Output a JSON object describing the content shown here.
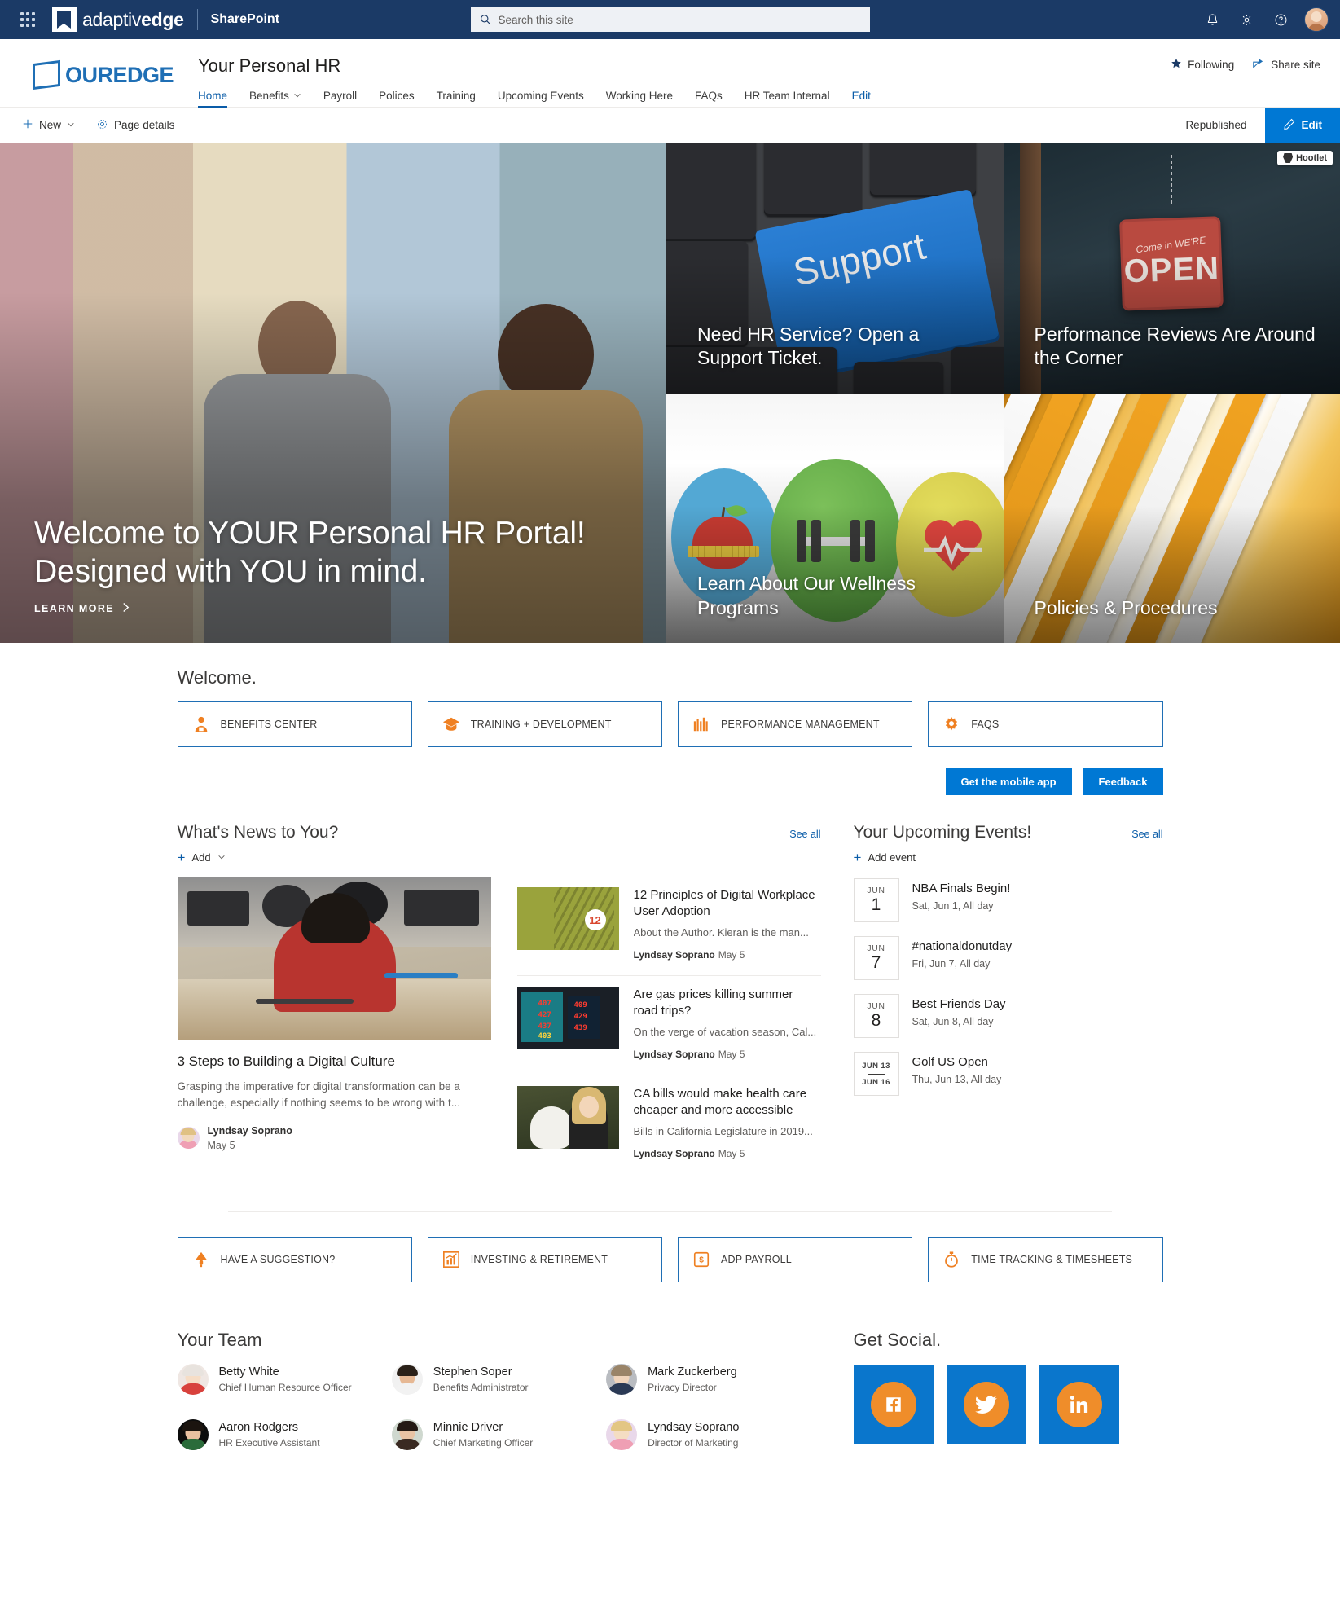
{
  "suite": {
    "brand_primary": "adaptiv",
    "brand_secondary": "edge",
    "app_name": "SharePoint",
    "search_placeholder": "Search this site",
    "search_value": "",
    "waffle_label": "app-launcher",
    "notifications_label": "Notifications",
    "settings_label": "Settings",
    "help_label": "Help",
    "bar_color": "#1b3a66"
  },
  "site": {
    "logo_text": "OUREDGE",
    "title": "Your Personal HR",
    "nav": [
      {
        "label": "Home",
        "active": true,
        "caret": false,
        "link": false
      },
      {
        "label": "Benefits",
        "active": false,
        "caret": true,
        "link": false
      },
      {
        "label": "Payroll",
        "active": false,
        "caret": false,
        "link": false
      },
      {
        "label": "Polices",
        "active": false,
        "caret": false,
        "link": false
      },
      {
        "label": "Training",
        "active": false,
        "caret": false,
        "link": false
      },
      {
        "label": "Upcoming Events",
        "active": false,
        "caret": false,
        "link": false
      },
      {
        "label": "Working Here",
        "active": false,
        "caret": false,
        "link": false
      },
      {
        "label": "FAQs",
        "active": false,
        "caret": false,
        "link": false
      },
      {
        "label": "HR Team Internal",
        "active": false,
        "caret": false,
        "link": false
      },
      {
        "label": "Edit",
        "active": false,
        "caret": false,
        "link": true
      }
    ],
    "following": "Following",
    "share_site": "Share site"
  },
  "commandbar": {
    "new": "New",
    "page_details": "Page details",
    "status": "Republished",
    "edit": "Edit",
    "edit_color": "#0078d4"
  },
  "hero": {
    "main": {
      "headline": "Welcome to YOUR Personal HR Portal! Designed with YOU in mind.",
      "cta": "LEARN MORE"
    },
    "tiles": [
      {
        "label": "Need HR Service? Open a Support Ticket.",
        "key_text": "Support"
      },
      {
        "label": "Performance Reviews Are Around the Corner",
        "sign_top": "Come in WE'RE",
        "sign_main": "OPEN",
        "watermark": "Hootlet"
      },
      {
        "label": "Learn About Our Wellness Programs"
      },
      {
        "label": "Policies & Procedures"
      }
    ]
  },
  "welcome": {
    "title": "Welcome.",
    "links": [
      {
        "label": "BENEFITS CENTER",
        "icon": "person-badge-icon"
      },
      {
        "label": "TRAINING + DEVELOPMENT",
        "icon": "graduation-cap-icon"
      },
      {
        "label": "PERFORMANCE MANAGEMENT",
        "icon": "bar-gauge-icon"
      },
      {
        "label": "FAQs",
        "icon": "gear-icon"
      }
    ],
    "mobile_app_button": "Get the mobile app",
    "feedback_button": "Feedback",
    "accent_color": "#ef8022",
    "border_color": "#1f6fb5"
  },
  "news": {
    "title": "What's News to You?",
    "see_all": "See all",
    "add": "Add",
    "feature": {
      "title": "3 Steps to Building a Digital Culture",
      "excerpt": "Grasping the imperative for digital transformation can be a challenge, especially if nothing seems to be wrong with t...",
      "author": "Lyndsay Soprano",
      "date": "May 5"
    },
    "items": [
      {
        "title": "12 Principles of Digital Workplace User Adoption",
        "desc": "About the Author. Kieran is the man...",
        "author": "Lyndsay Soprano",
        "date": "May 5",
        "badge": "12"
      },
      {
        "title": "Are gas prices killing summer road trips?",
        "desc": "On the verge of vacation season, Cal...",
        "author": "Lyndsay Soprano",
        "date": "May 5"
      },
      {
        "title": "CA bills would make health care cheaper and more accessible",
        "desc": "Bills in California Legislature in 2019...",
        "author": "Lyndsay Soprano",
        "date": "May 5"
      }
    ]
  },
  "events": {
    "title": "Your Upcoming Events!",
    "see_all": "See all",
    "add": "Add event",
    "items": [
      {
        "month": "JUN",
        "day": "1",
        "title": "NBA Finals Begin!",
        "when": "Sat, Jun 1, All day",
        "range": false
      },
      {
        "month": "JUN",
        "day": "7",
        "title": "#nationaldonutday",
        "when": "Fri, Jun 7, All day",
        "range": false
      },
      {
        "month": "JUN",
        "day": "8",
        "title": "Best Friends Day",
        "when": "Sat, Jun 8, All day",
        "range": false
      },
      {
        "start": "JUN 13",
        "end": "JUN 16",
        "title": "Golf US Open",
        "when": "Thu, Jun 13, All day",
        "range": true
      }
    ]
  },
  "quicklinks2": [
    {
      "label": "HAVE A SUGGESTION?",
      "icon": "megaphone-icon"
    },
    {
      "label": "INVESTING & RETIREMENT",
      "icon": "chart-growth-icon"
    },
    {
      "label": "ADP PAYROLL",
      "icon": "money-icon"
    },
    {
      "label": "TIME TRACKING & TIMESHEETS",
      "icon": "stopwatch-icon"
    }
  ],
  "team": {
    "title": "Your Team",
    "members": [
      {
        "name": "Betty White",
        "role": "Chief Human Resource Officer",
        "hair": "#e8e3de",
        "skin": "#f6ddc6",
        "shirt": "#d8413c",
        "bg": "#efe7e3"
      },
      {
        "name": "Stephen Soper",
        "role": "Benefits Administrator",
        "hair": "#2a2018",
        "skin": "#e6b894",
        "shirt": "#f2f2f2",
        "bg": "#f1f1f1"
      },
      {
        "name": "Mark Zuckerberg",
        "role": "Privacy Director",
        "hair": "#9a8468",
        "skin": "#f0d4bb",
        "shirt": "#2b3a55",
        "bg": "#b9bcc1"
      },
      {
        "name": "Aaron Rodgers",
        "role": "HR Executive Assistant",
        "hair": "#1b140f",
        "skin": "#e8c0a0",
        "shirt": "#2a6b3a",
        "bg": "#0c0c0c"
      },
      {
        "name": "Minnie Driver",
        "role": "Chief Marketing Officer",
        "hair": "#241a14",
        "skin": "#e8c3a4",
        "shirt": "#3a2a22",
        "bg": "#cfd8cf"
      },
      {
        "name": "Lyndsay Soprano",
        "role": "Director of Marketing",
        "hair": "#e3c684",
        "skin": "#f4ddc3",
        "shirt": "#ef9fb4",
        "bg": "#e9d8ea"
      }
    ]
  },
  "social": {
    "title": "Get Social.",
    "tile_color": "#0a76cc",
    "circle_color": "#ef8d2a",
    "items": [
      {
        "name": "facebook-icon",
        "label": "Facebook"
      },
      {
        "name": "twitter-icon",
        "label": "Twitter"
      },
      {
        "name": "linkedin-icon",
        "label": "LinkedIn"
      }
    ]
  }
}
